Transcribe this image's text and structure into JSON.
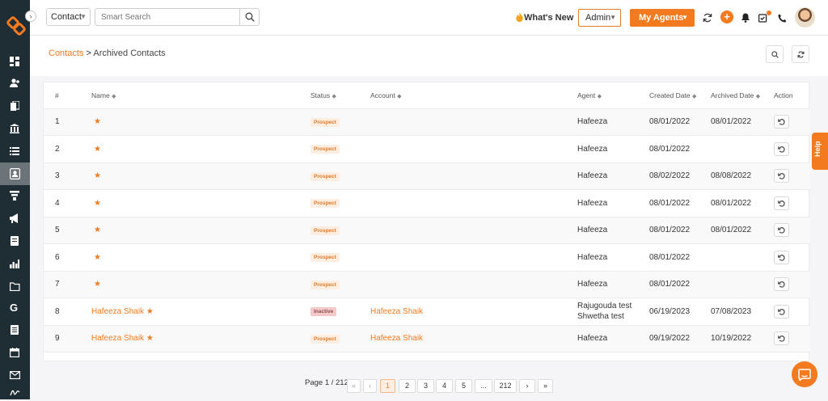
{
  "topbar": {
    "module_select": "Contact",
    "search_placeholder": "Smart Search",
    "whats_new": "What's New",
    "role_select": "Admin",
    "my_agents": "My Agents"
  },
  "breadcrumb": {
    "root": "Contacts",
    "separator": ">",
    "current": "Archived Contacts"
  },
  "table": {
    "columns": [
      "#",
      "Name",
      "Status",
      "Account",
      "Agent",
      "Created Date",
      "Archived Date",
      "Action"
    ],
    "rows": [
      {
        "num": "1",
        "name": "",
        "status": "Prospect",
        "account": "",
        "agent": "Hafeeza",
        "agent2": "",
        "created": "08/01/2022",
        "archived": "08/01/2022"
      },
      {
        "num": "2",
        "name": "",
        "status": "Prospect",
        "account": "",
        "agent": "Hafeeza",
        "agent2": "",
        "created": "08/01/2022",
        "archived": ""
      },
      {
        "num": "3",
        "name": "",
        "status": "Prospect",
        "account": "",
        "agent": "Hafeeza",
        "agent2": "",
        "created": "08/02/2022",
        "archived": "08/08/2022"
      },
      {
        "num": "4",
        "name": "",
        "status": "Prospect",
        "account": "",
        "agent": "Hafeeza",
        "agent2": "",
        "created": "08/01/2022",
        "archived": "08/01/2022"
      },
      {
        "num": "5",
        "name": "",
        "status": "Prospect",
        "account": "",
        "agent": "Hafeeza",
        "agent2": "",
        "created": "08/01/2022",
        "archived": "08/01/2022"
      },
      {
        "num": "6",
        "name": "",
        "status": "Prospect",
        "account": "",
        "agent": "Hafeeza",
        "agent2": "",
        "created": "08/01/2022",
        "archived": ""
      },
      {
        "num": "7",
        "name": "",
        "status": "Prospect",
        "account": "",
        "agent": "Hafeeza",
        "agent2": "",
        "created": "08/01/2022",
        "archived": ""
      },
      {
        "num": "8",
        "name": "Hafeeza Shaik",
        "status": "Inactive",
        "account": "Hafeeza Shaik",
        "agent": "Rajugouda test",
        "agent2": "Shwetha test",
        "created": "06/19/2023",
        "archived": "07/08/2023"
      },
      {
        "num": "9",
        "name": "Hafeeza Shaik",
        "status": "Prospect",
        "account": "Hafeeza Shaik",
        "agent": "Hafeeza",
        "agent2": "",
        "created": "09/19/2022",
        "archived": "10/19/2022"
      }
    ]
  },
  "pagination": {
    "label": "Page 1 / 212",
    "first": "«",
    "prev": "‹",
    "pages": [
      "1",
      "2",
      "3",
      "4",
      "5",
      "...",
      "212"
    ],
    "next": "›",
    "last": "»"
  },
  "help_tab": "Help",
  "colors": {
    "accent": "#f47a20",
    "sidebar": "#1f2d35"
  }
}
